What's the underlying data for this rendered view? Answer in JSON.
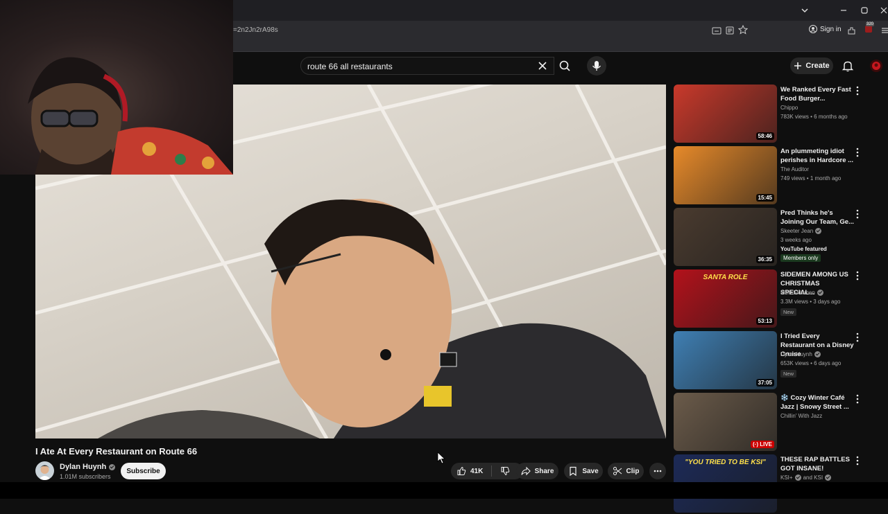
{
  "browser": {
    "url_fragment": "=2n2Jn2rA98s",
    "sign_in_label": "Sign in",
    "extension_badge": "320"
  },
  "search": {
    "query": "route 66 all restaurants"
  },
  "header": {
    "create_label": "Create"
  },
  "video": {
    "title": "I Ate At Every Restaurant on Route 66",
    "channel_name": "Dylan Huynh",
    "subscribers": "1.01M subscribers",
    "subscribe_label": "Subscribe",
    "like_count": "41K",
    "share_label": "Share",
    "save_label": "Save",
    "clip_label": "Clip"
  },
  "recommendations": [
    {
      "title": "We Ranked Every Fast Food Burger...",
      "channel": "Chippo",
      "verified": false,
      "stats": "783K views • 6 months ago",
      "duration": "58:46",
      "thumb_color": "#c9392b"
    },
    {
      "title": "An plummeting idiot perishes in Hardcore ...",
      "channel": "The Auditor",
      "verified": false,
      "stats": "749 views • 1 month ago",
      "duration": "15:45",
      "thumb_color": "#e78a2a"
    },
    {
      "title": "Pred Thinks he's Joining Our Team, Ge...",
      "channel": "Skeeter Jean",
      "verified": true,
      "stats": "3 weeks ago",
      "extra": "YouTube featured",
      "members": "Members only",
      "duration": "36:35",
      "thumb_color": "#4a3b2f"
    },
    {
      "title": "SIDEMEN AMONG US CHRISTMAS SPECIAL...",
      "channel": "MoreSidemen",
      "verified": true,
      "stats": "3.3M views • 3 days ago",
      "badge": "New",
      "duration": "53:13",
      "thumb_text": "SANTA ROLE",
      "thumb_color": "#b3121b"
    },
    {
      "title": "I Tried Every Restaurant on a Disney Cruise",
      "channel": "Dylan Huynh",
      "verified": true,
      "stats": "653K views • 6 days ago",
      "badge": "New",
      "duration": "37:05",
      "thumb_color": "#3f7fb3"
    },
    {
      "title": "❄️ Cozy Winter Café Jazz | Snowy Street ...",
      "channel": "Chillin' With Jazz",
      "verified": false,
      "stats": "",
      "live": "LIVE",
      "thumb_color": "#6b5b4a"
    },
    {
      "title": "THESE RAP BATTLES GOT INSANE!",
      "channel": "KSI+",
      "channel_suffix": "and KSI",
      "verified": true,
      "stats": "",
      "thumb_text": "\"YOU TRIED TO BE KSI\"",
      "thumb_color": "#1c2a57"
    }
  ]
}
